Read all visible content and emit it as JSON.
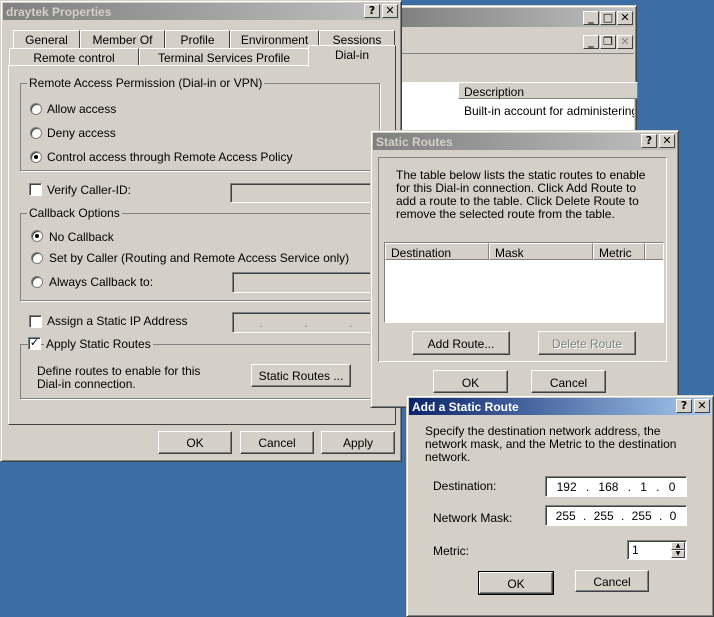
{
  "draytek": {
    "title": "draytek Properties",
    "tabs_row1": [
      "General",
      "Member Of",
      "Profile",
      "Environment",
      "Sessions"
    ],
    "tabs_row2": [
      "Remote control",
      "Terminal Services Profile",
      "Dial-in"
    ],
    "remote_access": {
      "group_label": "Remote Access Permission (Dial-in or VPN)",
      "allow_access": "Allow access",
      "deny_access": "Deny access",
      "control_access": "Control access through Remote Access Policy",
      "selected": "control_access"
    },
    "verify_caller_id": "Verify Caller-ID:",
    "callback": {
      "group_label": "Callback Options",
      "no_callback": "No Callback",
      "set_by_caller": "Set by Caller (Routing and Remote Access Service only)",
      "always_callback": "Always Callback to:",
      "selected": "no_callback"
    },
    "assign_static_ip": "Assign a Static IP Address",
    "apply_static_routes": "Apply Static Routes",
    "apply_static_routes_checked": true,
    "static_routes_description": "Define routes to enable for this Dial-in connection.",
    "static_routes_button": "Static Routes ...",
    "ok": "OK",
    "cancel": "Cancel",
    "apply": "Apply"
  },
  "bg_window": {
    "column_description": "Description",
    "row_description": "Built-in account for administering th"
  },
  "static_routes": {
    "title": "Static Routes",
    "description": "The table below lists the static routes to enable for this Dial-in connection. Click Add Route to add a route to the table. Click Delete Route to remove the selected route from the table.",
    "columns": [
      "Destination",
      "Mask",
      "Metric"
    ],
    "add_route": "Add Route...",
    "delete_route": "Delete Route",
    "ok": "OK",
    "cancel": "Cancel"
  },
  "add_route": {
    "title": "Add a Static Route",
    "description": "Specify the destination network address, the network mask, and the Metric to the destination network.",
    "destination_label": "Destination:",
    "destination": [
      "192",
      "168",
      "1",
      "0"
    ],
    "mask_label": "Network Mask:",
    "mask": [
      "255",
      "255",
      "255",
      "0"
    ],
    "metric_label": "Metric:",
    "metric": "1",
    "ok": "OK",
    "cancel": "Cancel"
  },
  "icons": {
    "help": "?",
    "close": "✕",
    "minimize": "_",
    "maximize": "□",
    "restore": "❐",
    "check": "✓"
  }
}
